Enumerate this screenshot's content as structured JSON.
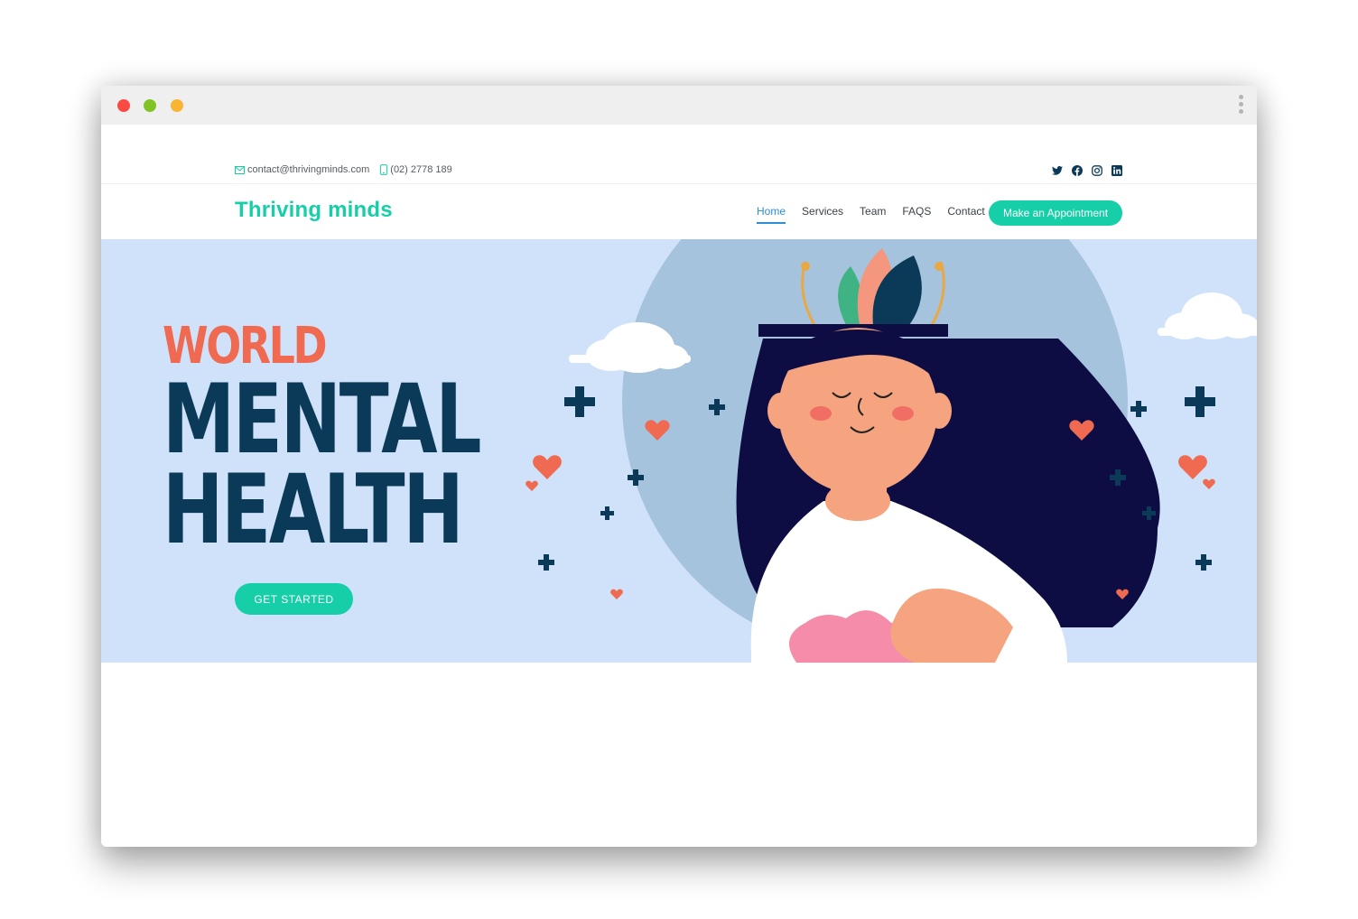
{
  "window": {
    "controls": [
      "close",
      "minimize",
      "maximize"
    ]
  },
  "topbar": {
    "email": "contact@thrivingminds.com",
    "phone": "(02) 2778 189",
    "social": [
      "twitter-icon",
      "facebook-icon",
      "instagram-icon",
      "linkedin-icon"
    ]
  },
  "nav": {
    "logo": "Thriving minds",
    "items": [
      {
        "label": "Home",
        "active": true
      },
      {
        "label": "Services"
      },
      {
        "label": "Team"
      },
      {
        "label": "FAQS"
      },
      {
        "label": "Contact"
      }
    ],
    "appointment": "Make an Appointment"
  },
  "hero": {
    "line1": "WORLD",
    "line2": "MENTAL",
    "line3": "HEALTH",
    "cta": "GET STARTED"
  },
  "colors": {
    "brand": "#16cfa8",
    "hero_bg": "#cfe2fa",
    "headline_dark": "#0b3a59",
    "headline_accent": "#ef6a50",
    "nav_active": "#2b8fd6"
  }
}
